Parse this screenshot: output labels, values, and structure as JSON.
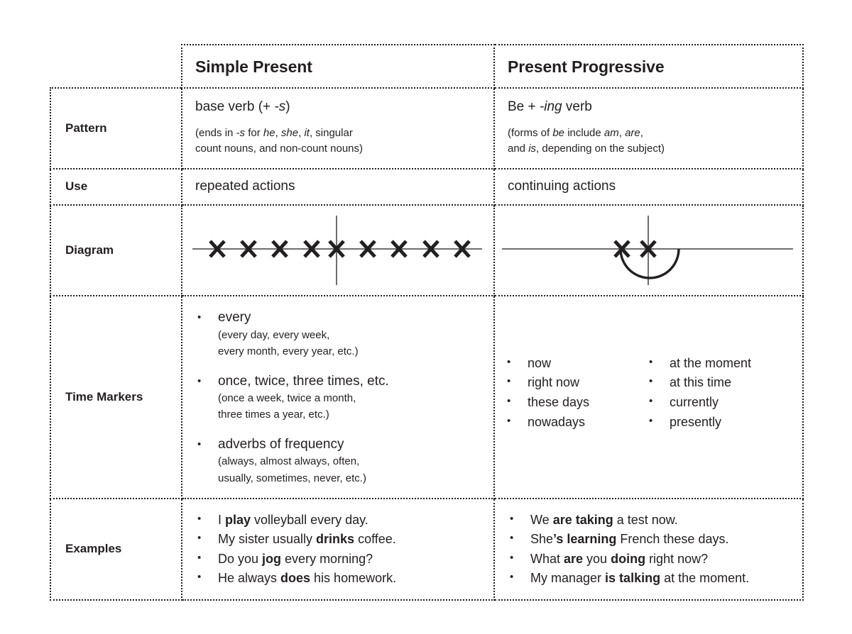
{
  "table": {
    "columns": [
      "Simple Present",
      "Present Progressive"
    ],
    "row_labels": [
      "Pattern",
      "Use",
      "Diagram",
      "Time Markers",
      "Examples"
    ],
    "pattern": {
      "simple_present": {
        "lead_plain": "base verb (+ ",
        "lead_italic": "-s",
        "lead_tail": ")",
        "note_line1_a": "(ends in ",
        "note_line1_s": "-s",
        "note_line1_b": " for ",
        "note_line1_he": "he",
        "note_line1_c": ", ",
        "note_line1_she": "she",
        "note_line1_d": ", ",
        "note_line1_it": "it",
        "note_line1_e": ", singular",
        "note_line2": "count nouns, and non-count nouns)"
      },
      "present_progressive": {
        "lead_plain": "Be + ",
        "lead_italic": "-ing",
        "lead_tail": " verb",
        "note_line1_a": "(forms of ",
        "note_line1_be": "be",
        "note_line1_b": " include ",
        "note_line1_am": "am",
        "note_line1_c": ", ",
        "note_line1_are": "are",
        "note_line1_d": ",",
        "note_line2_a": "and ",
        "note_line2_is": "is",
        "note_line2_b": ", depending on the subject)"
      }
    },
    "use": {
      "simple_present": "repeated actions",
      "present_progressive": "continuing actions"
    },
    "time_markers": {
      "simple_present": [
        {
          "head": "every",
          "desc_lines": [
            "(every day, every week,",
            "every month, every year, etc.)"
          ]
        },
        {
          "head": "once, twice, three times, etc.",
          "desc_lines": [
            "(once a week, twice a month,",
            " three times a year, etc.)"
          ]
        },
        {
          "head": "adverbs of frequency",
          "desc_lines": [
            "(always, almost always, often,",
            "usually, sometimes, never, etc.)"
          ]
        }
      ],
      "present_progressive_col1": [
        "now",
        "right now",
        "these days",
        "nowadays"
      ],
      "present_progressive_col2": [
        "at the moment",
        "at this time",
        "currently",
        "presently"
      ]
    },
    "examples": {
      "simple_present": [
        {
          "pre": "I ",
          "bold": "play",
          "post": " volleyball every day."
        },
        {
          "pre": "My sister usually ",
          "bold": "drinks",
          "post": " coffee."
        },
        {
          "pre": "Do you ",
          "bold": "jog",
          "post": " every morning?"
        },
        {
          "pre": "He always ",
          "bold": "does",
          "post": " his homework."
        }
      ],
      "present_progressive": [
        {
          "pre": "We ",
          "bold": "are taking",
          "post": " a test now.",
          "bold2": "",
          "post2": ""
        },
        {
          "pre": "She",
          "bold": "’s learning",
          "post": " French these days.",
          "bold2": "",
          "post2": ""
        },
        {
          "pre": "What ",
          "bold": "are",
          "post": " you ",
          "bold2": "doing",
          "post2": " right now?"
        },
        {
          "pre": "My manager ",
          "bold": "is talking",
          "post": " at the moment.",
          "bold2": "",
          "post2": ""
        }
      ]
    }
  },
  "diagrams": {
    "simple_present": {
      "description": "timeline with nine evenly spaced X marks and a vertical now-line at the centre X",
      "x_count": 9,
      "now_line_index": 5
    },
    "present_progressive": {
      "description": "timeline with two adjacent X marks, a vertical now-line between them and a semicircular arc below spanning both",
      "x_count": 2,
      "arc": "semicircle below the line"
    }
  },
  "colors": {
    "ink": "#231f20",
    "rule": "#6d6e71",
    "border": "#231f20",
    "background": "#ffffff"
  }
}
